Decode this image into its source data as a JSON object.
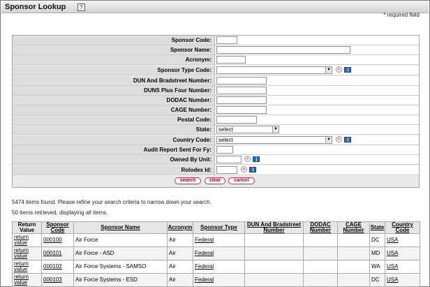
{
  "header": {
    "title": "Sponsor Lookup",
    "help_label": "?",
    "required_note": "* required field"
  },
  "form": {
    "fields": [
      {
        "label": "Sponsor Code:",
        "type": "text"
      },
      {
        "label": "Sponsor Name:",
        "type": "text"
      },
      {
        "label": "Acronym:",
        "type": "text"
      },
      {
        "label": "Sponsor Type Code:",
        "type": "select",
        "value": ""
      },
      {
        "label": "DUN And Bradstreet Number:",
        "type": "text"
      },
      {
        "label": "DUNS Plus Four Number:",
        "type": "text"
      },
      {
        "label": "DODAC Number:",
        "type": "text"
      },
      {
        "label": "CAGE Number:",
        "type": "text"
      },
      {
        "label": "Postal Code:",
        "type": "text"
      },
      {
        "label": "State:",
        "type": "select",
        "value": "select"
      },
      {
        "label": "Country Code:",
        "type": "select",
        "value": "select"
      },
      {
        "label": "Audit Report Sent For Fy:",
        "type": "text"
      },
      {
        "label": "Owned By Unit:",
        "type": "text"
      },
      {
        "label": "Rolodex Id:",
        "type": "text"
      }
    ],
    "buttons": {
      "search": "search",
      "clear": "clear",
      "cancel": "cancel"
    }
  },
  "results": {
    "found_message": "5474 items found. Please refine your search criteria to narrow down your search.",
    "retrieved_message": "50 items retrieved, displaying all items.",
    "columns": [
      "Return Value",
      "Sponsor Code",
      "Sponsor Name",
      "Acronym",
      "Sponsor Type",
      "DUN And Bradstreet Number",
      "DODAC Number",
      "CAGE Number",
      "State",
      "Country Code"
    ],
    "rows": [
      {
        "return": "return value",
        "code": "000100",
        "name": "Air Force",
        "acronym": "Air",
        "type": "Federal",
        "dun": "",
        "dodac": "",
        "cage": "",
        "state": "DC",
        "country": "USA"
      },
      {
        "return": "return value",
        "code": "000101",
        "name": "Air Force - ASD",
        "acronym": "Air",
        "type": "Federal",
        "dun": "",
        "dodac": "",
        "cage": "",
        "state": "MD",
        "country": "USA"
      },
      {
        "return": "return value",
        "code": "000102",
        "name": "Air Force Systems - SAMSO",
        "acronym": "Air",
        "type": "Federal",
        "dun": "",
        "dodac": "",
        "cage": "",
        "state": "WA",
        "country": "USA"
      },
      {
        "return": "return value",
        "code": "000103",
        "name": "Air Force Systems - ESD",
        "acronym": "Air",
        "type": "Federal",
        "dun": "",
        "dodac": "",
        "cage": "",
        "state": "DC",
        "country": "USA"
      }
    ]
  }
}
